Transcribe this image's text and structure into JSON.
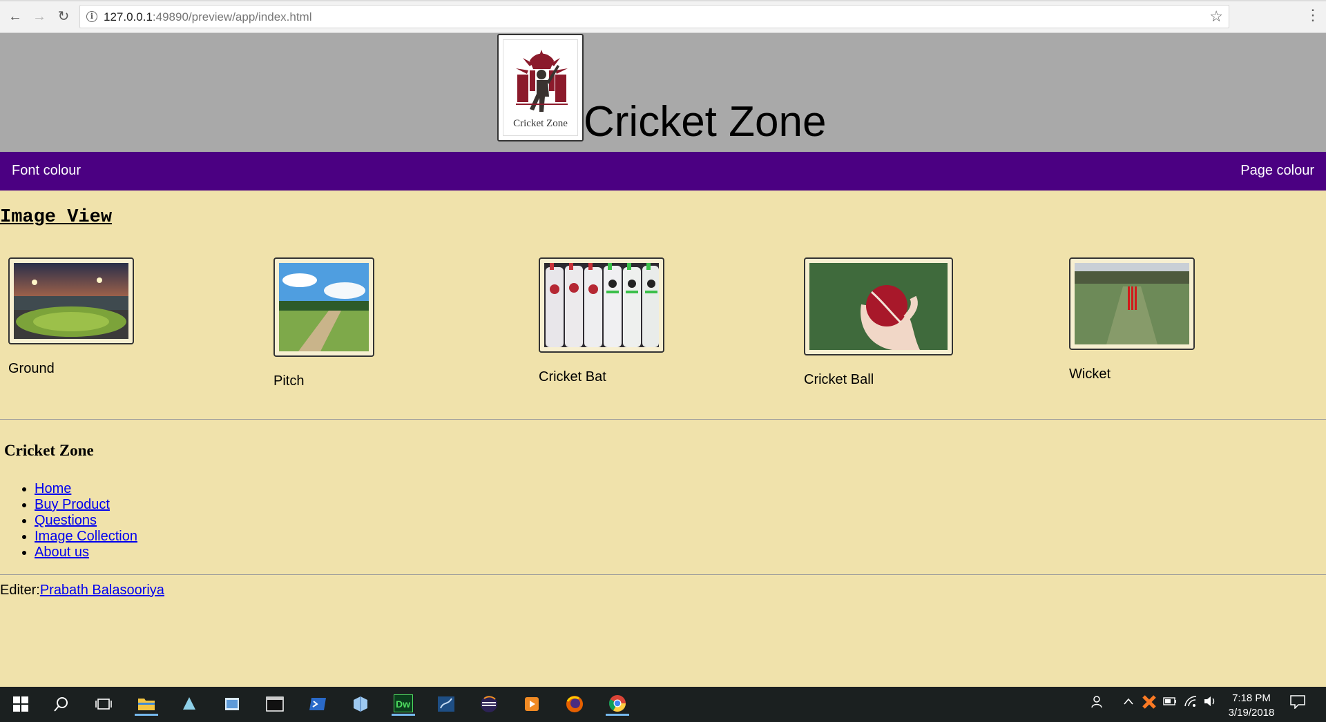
{
  "browser": {
    "url_host": "127.0.0.1",
    "url_path": ":49890/preview/app/index.html"
  },
  "header": {
    "logo_caption": "Cricket Zone",
    "title": "Cricket Zone"
  },
  "navbar": {
    "left_label": "Font colour",
    "right_label": "Page colour"
  },
  "main": {
    "section_title": "Image View",
    "gallery": [
      {
        "caption": "Ground"
      },
      {
        "caption": "Pitch"
      },
      {
        "caption": "Cricket Bat"
      },
      {
        "caption": "Cricket Ball"
      },
      {
        "caption": "Wicket"
      }
    ]
  },
  "footer": {
    "title": "Cricket Zone",
    "links": [
      "Home",
      "Buy Product",
      "Questions",
      "Image Collection",
      "About us"
    ],
    "editor_label": "Editer:",
    "editor_name": "Prabath Balasooriya"
  },
  "taskbar": {
    "time": "7:18 PM",
    "date": "3/19/2018"
  },
  "colors": {
    "page_bg": "#f0e2ab",
    "header_bg": "#a9a9a9",
    "navbar_bg": "#4b0082",
    "link": "#0000ee"
  }
}
